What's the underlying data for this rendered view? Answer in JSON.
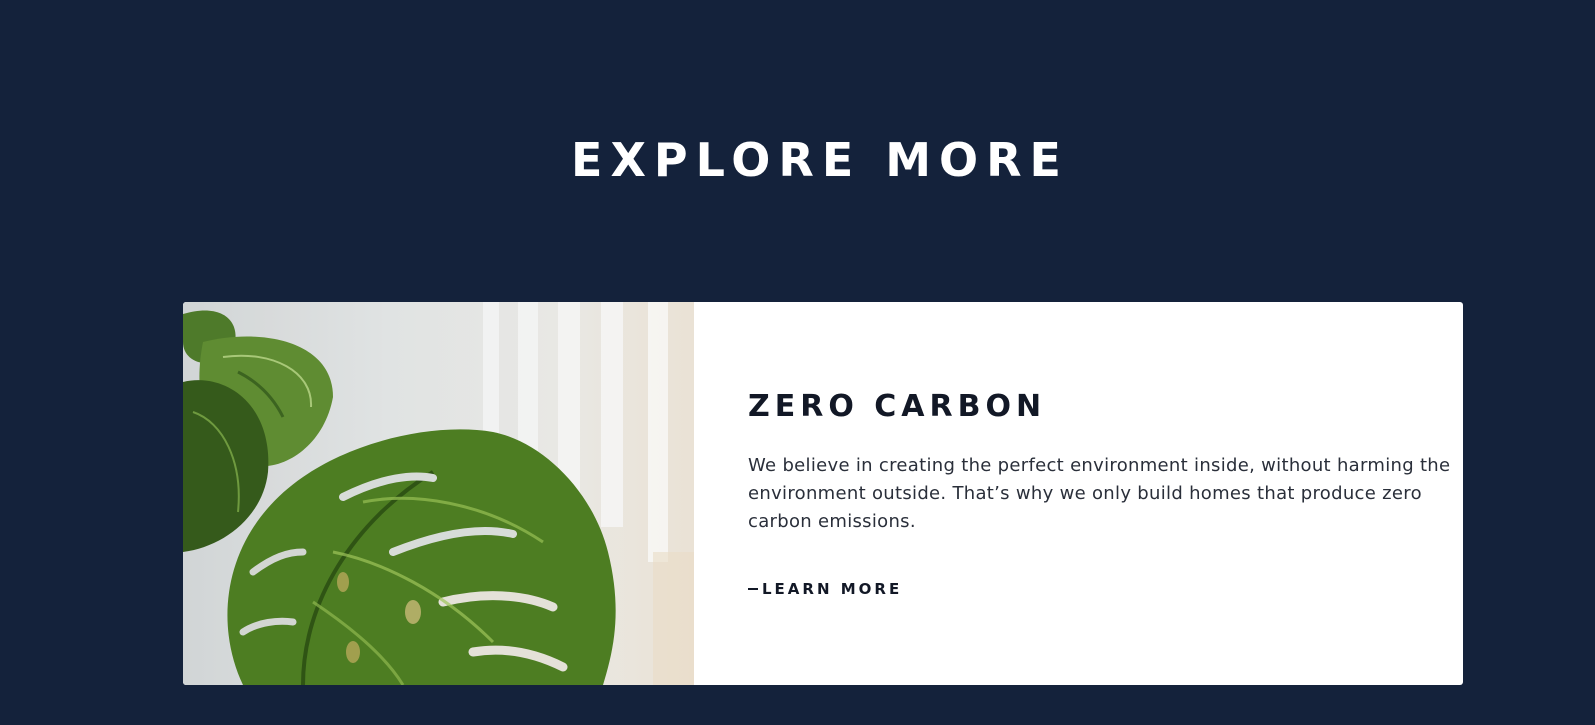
{
  "section": {
    "title": "EXPLORE MORE"
  },
  "card": {
    "image_alt": "monstera-leaf-plant",
    "heading": "ZERO CARBON",
    "description": "We believe in creating the perfect environment inside, without harming the environment outside. That’s why we only build homes that produce zero carbon emissions.",
    "link_label": "LEARN MORE"
  },
  "colors": {
    "background": "#14223b",
    "card": "#ffffff",
    "text_dark": "#121826"
  }
}
